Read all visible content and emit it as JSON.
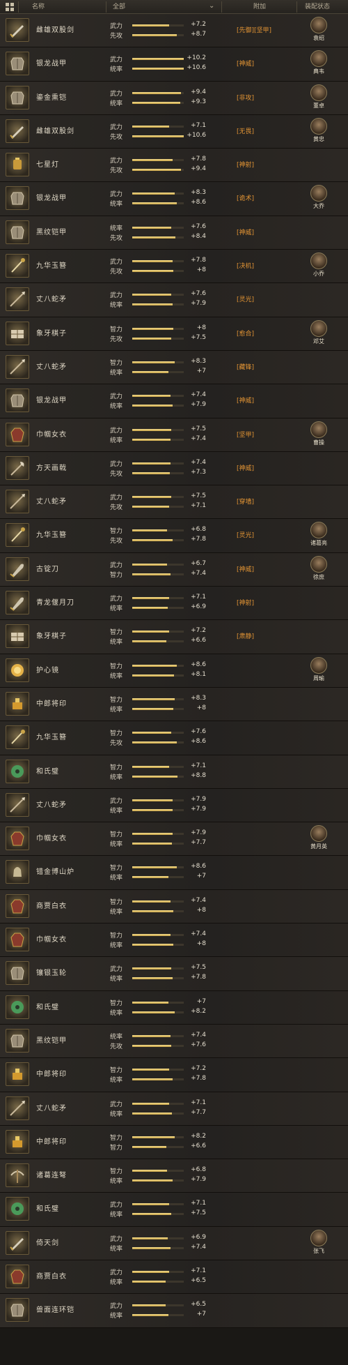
{
  "header": {
    "col_name": "名称",
    "col_all": "全部",
    "col_extra": "附加",
    "col_equip": "装配状态",
    "dropdown_icon": "chevron-down-icon"
  },
  "colors": {
    "extra_text": "#e29434",
    "bar_fill": "#e8c865"
  },
  "items": [
    {
      "name": "雌雄双股剑",
      "icon": "sword-icon",
      "stats": [
        {
          "label": "武力",
          "value": "+7.2",
          "fill": 0.72
        },
        {
          "label": "先攻",
          "value": "+8.7",
          "fill": 0.87
        }
      ],
      "extra": "[先御][坚甲]",
      "equipped": "袁绍"
    },
    {
      "name": "银龙战甲",
      "icon": "armor-icon",
      "stats": [
        {
          "label": "武力",
          "value": "+10.2",
          "fill": 1.0
        },
        {
          "label": "统率",
          "value": "+10.6",
          "fill": 1.0
        }
      ],
      "extra": "[神威]",
      "equipped": "典韦"
    },
    {
      "name": "鎏金熏铠",
      "icon": "armor-icon",
      "stats": [
        {
          "label": "武力",
          "value": "+9.4",
          "fill": 0.94
        },
        {
          "label": "统率",
          "value": "+9.3",
          "fill": 0.93
        }
      ],
      "extra": "[非攻]",
      "equipped": "董卓"
    },
    {
      "name": "雌雄双股剑",
      "icon": "sword-icon",
      "stats": [
        {
          "label": "武力",
          "value": "+7.1",
          "fill": 0.71
        },
        {
          "label": "先攻",
          "value": "+10.6",
          "fill": 1.0
        }
      ],
      "extra": "[无畏]",
      "equipped": "黄忠"
    },
    {
      "name": "七星灯",
      "icon": "lamp-icon",
      "stats": [
        {
          "label": "武力",
          "value": "+7.8",
          "fill": 0.78
        },
        {
          "label": "先攻",
          "value": "+9.4",
          "fill": 0.94
        }
      ],
      "extra": "[神射]",
      "equipped": ""
    },
    {
      "name": "银龙战甲",
      "icon": "armor-icon",
      "stats": [
        {
          "label": "武力",
          "value": "+8.3",
          "fill": 0.83
        },
        {
          "label": "统率",
          "value": "+8.6",
          "fill": 0.86
        }
      ],
      "extra": "[诡术]",
      "equipped": "大乔"
    },
    {
      "name": "黑纹铠甲",
      "icon": "armor-icon",
      "stats": [
        {
          "label": "统率",
          "value": "+7.6",
          "fill": 0.76
        },
        {
          "label": "先攻",
          "value": "+8.4",
          "fill": 0.84
        }
      ],
      "extra": "[神威]",
      "equipped": ""
    },
    {
      "name": "九华玉簪",
      "icon": "hairpin-icon",
      "stats": [
        {
          "label": "武力",
          "value": "+7.8",
          "fill": 0.78
        },
        {
          "label": "先攻",
          "value": "+8",
          "fill": 0.8
        }
      ],
      "extra": "[决机]",
      "equipped": "小乔"
    },
    {
      "name": "丈八蛇矛",
      "icon": "spear-icon",
      "stats": [
        {
          "label": "武力",
          "value": "+7.6",
          "fill": 0.76
        },
        {
          "label": "统率",
          "value": "+7.9",
          "fill": 0.79
        }
      ],
      "extra": "[灵光]",
      "equipped": ""
    },
    {
      "name": "象牙棋子",
      "icon": "chess-icon",
      "stats": [
        {
          "label": "智力",
          "value": "+8",
          "fill": 0.8
        },
        {
          "label": "先攻",
          "value": "+7.5",
          "fill": 0.75
        }
      ],
      "extra": "[愈合]",
      "equipped": "邓艾"
    },
    {
      "name": "丈八蛇矛",
      "icon": "spear-icon",
      "stats": [
        {
          "label": "智力",
          "value": "+8.3",
          "fill": 0.83
        },
        {
          "label": "统率",
          "value": "+7",
          "fill": 0.7
        }
      ],
      "extra": "[藏锋]",
      "equipped": ""
    },
    {
      "name": "银龙战甲",
      "icon": "armor-icon",
      "stats": [
        {
          "label": "武力",
          "value": "+7.4",
          "fill": 0.74
        },
        {
          "label": "统率",
          "value": "+7.9",
          "fill": 0.79
        }
      ],
      "extra": "[神威]",
      "equipped": ""
    },
    {
      "name": "巾帼女衣",
      "icon": "robe-icon",
      "stats": [
        {
          "label": "武力",
          "value": "+7.5",
          "fill": 0.75
        },
        {
          "label": "统率",
          "value": "+7.4",
          "fill": 0.74
        }
      ],
      "extra": "[坚甲]",
      "equipped": "曹操"
    },
    {
      "name": "方天画戟",
      "icon": "halberd-icon",
      "stats": [
        {
          "label": "武力",
          "value": "+7.4",
          "fill": 0.74
        },
        {
          "label": "先攻",
          "value": "+7.3",
          "fill": 0.73
        }
      ],
      "extra": "[神威]",
      "equipped": ""
    },
    {
      "name": "丈八蛇矛",
      "icon": "spear-icon",
      "stats": [
        {
          "label": "武力",
          "value": "+7.5",
          "fill": 0.75
        },
        {
          "label": "先攻",
          "value": "+7.1",
          "fill": 0.71
        }
      ],
      "extra": "[穿墙]",
      "equipped": ""
    },
    {
      "name": "九华玉簪",
      "icon": "hairpin-icon",
      "stats": [
        {
          "label": "智力",
          "value": "+6.8",
          "fill": 0.68
        },
        {
          "label": "先攻",
          "value": "+7.8",
          "fill": 0.78
        }
      ],
      "extra": "[灵光]",
      "equipped": "诸葛亮"
    },
    {
      "name": "古锭刀",
      "icon": "blade-icon",
      "stats": [
        {
          "label": "武力",
          "value": "+6.7",
          "fill": 0.67
        },
        {
          "label": "智力",
          "value": "+7.4",
          "fill": 0.74
        }
      ],
      "extra": "[神威]",
      "equipped": "徐庶"
    },
    {
      "name": "青龙偃月刀",
      "icon": "blade-icon",
      "stats": [
        {
          "label": "武力",
          "value": "+7.1",
          "fill": 0.71
        },
        {
          "label": "统率",
          "value": "+6.9",
          "fill": 0.69
        }
      ],
      "extra": "[神射]",
      "equipped": ""
    },
    {
      "name": "象牙棋子",
      "icon": "chess-icon",
      "stats": [
        {
          "label": "智力",
          "value": "+7.2",
          "fill": 0.72
        },
        {
          "label": "统率",
          "value": "+6.6",
          "fill": 0.66
        }
      ],
      "extra": "[肃静]",
      "equipped": ""
    },
    {
      "name": "护心镜",
      "icon": "mirror-icon",
      "stats": [
        {
          "label": "智力",
          "value": "+8.6",
          "fill": 0.86
        },
        {
          "label": "统率",
          "value": "+8.1",
          "fill": 0.81
        }
      ],
      "extra": "",
      "equipped": "周瑜"
    },
    {
      "name": "中郎将印",
      "icon": "seal-icon",
      "stats": [
        {
          "label": "智力",
          "value": "+8.3",
          "fill": 0.83
        },
        {
          "label": "统率",
          "value": "+8",
          "fill": 0.8
        }
      ],
      "extra": "",
      "equipped": ""
    },
    {
      "name": "九华玉簪",
      "icon": "hairpin-icon",
      "stats": [
        {
          "label": "智力",
          "value": "+7.6",
          "fill": 0.76
        },
        {
          "label": "先攻",
          "value": "+8.6",
          "fill": 0.86
        }
      ],
      "extra": "",
      "equipped": ""
    },
    {
      "name": "和氏璧",
      "icon": "jade-icon",
      "stats": [
        {
          "label": "智力",
          "value": "+7.1",
          "fill": 0.71
        },
        {
          "label": "统率",
          "value": "+8.8",
          "fill": 0.88
        }
      ],
      "extra": "",
      "equipped": ""
    },
    {
      "name": "丈八蛇矛",
      "icon": "spear-icon",
      "stats": [
        {
          "label": "武力",
          "value": "+7.9",
          "fill": 0.79
        },
        {
          "label": "统率",
          "value": "+7.9",
          "fill": 0.79
        }
      ],
      "extra": "",
      "equipped": ""
    },
    {
      "name": "巾帼女衣",
      "icon": "robe-icon",
      "stats": [
        {
          "label": "智力",
          "value": "+7.9",
          "fill": 0.79
        },
        {
          "label": "统率",
          "value": "+7.7",
          "fill": 0.77
        }
      ],
      "extra": "",
      "equipped": "黄月英"
    },
    {
      "name": "错金博山炉",
      "icon": "censer-icon",
      "stats": [
        {
          "label": "智力",
          "value": "+8.6",
          "fill": 0.86
        },
        {
          "label": "统率",
          "value": "+7",
          "fill": 0.7
        }
      ],
      "extra": "",
      "equipped": ""
    },
    {
      "name": "商贾白衣",
      "icon": "robe-icon",
      "stats": [
        {
          "label": "智力",
          "value": "+7.4",
          "fill": 0.74
        },
        {
          "label": "统率",
          "value": "+8",
          "fill": 0.8
        }
      ],
      "extra": "",
      "equipped": ""
    },
    {
      "name": "巾帼女衣",
      "icon": "robe-icon",
      "stats": [
        {
          "label": "智力",
          "value": "+7.4",
          "fill": 0.74
        },
        {
          "label": "统率",
          "value": "+8",
          "fill": 0.8
        }
      ],
      "extra": "",
      "equipped": ""
    },
    {
      "name": "镶银玉轮",
      "icon": "armor-icon",
      "stats": [
        {
          "label": "武力",
          "value": "+7.5",
          "fill": 0.75
        },
        {
          "label": "统率",
          "value": "+7.8",
          "fill": 0.78
        }
      ],
      "extra": "",
      "equipped": ""
    },
    {
      "name": "和氏璧",
      "icon": "jade-icon",
      "stats": [
        {
          "label": "智力",
          "value": "+7",
          "fill": 0.7
        },
        {
          "label": "统率",
          "value": "+8.2",
          "fill": 0.82
        }
      ],
      "extra": "",
      "equipped": ""
    },
    {
      "name": "黑纹铠甲",
      "icon": "armor-icon",
      "stats": [
        {
          "label": "统率",
          "value": "+7.4",
          "fill": 0.74
        },
        {
          "label": "先攻",
          "value": "+7.6",
          "fill": 0.76
        }
      ],
      "extra": "",
      "equipped": ""
    },
    {
      "name": "中郎将印",
      "icon": "seal-icon",
      "stats": [
        {
          "label": "智力",
          "value": "+7.2",
          "fill": 0.72
        },
        {
          "label": "统率",
          "value": "+7.8",
          "fill": 0.78
        }
      ],
      "extra": "",
      "equipped": ""
    },
    {
      "name": "丈八蛇矛",
      "icon": "spear-icon",
      "stats": [
        {
          "label": "武力",
          "value": "+7.1",
          "fill": 0.71
        },
        {
          "label": "统率",
          "value": "+7.7",
          "fill": 0.77
        }
      ],
      "extra": "",
      "equipped": ""
    },
    {
      "name": "中郎将印",
      "icon": "seal-icon",
      "stats": [
        {
          "label": "智力",
          "value": "+8.2",
          "fill": 0.82
        },
        {
          "label": "智力",
          "value": "+6.6",
          "fill": 0.66
        }
      ],
      "extra": "",
      "equipped": ""
    },
    {
      "name": "诸葛连弩",
      "icon": "crossbow-icon",
      "stats": [
        {
          "label": "智力",
          "value": "+6.8",
          "fill": 0.68
        },
        {
          "label": "统率",
          "value": "+7.9",
          "fill": 0.79
        }
      ],
      "extra": "",
      "equipped": ""
    },
    {
      "name": "和氏璧",
      "icon": "jade-icon",
      "stats": [
        {
          "label": "武力",
          "value": "+7.1",
          "fill": 0.71
        },
        {
          "label": "统率",
          "value": "+7.5",
          "fill": 0.75
        }
      ],
      "extra": "",
      "equipped": ""
    },
    {
      "name": "倚天剑",
      "icon": "sword-icon",
      "stats": [
        {
          "label": "武力",
          "value": "+6.9",
          "fill": 0.69
        },
        {
          "label": "统率",
          "value": "+7.4",
          "fill": 0.74
        }
      ],
      "extra": "",
      "equipped": "张飞"
    },
    {
      "name": "商贾白衣",
      "icon": "robe-icon",
      "stats": [
        {
          "label": "武力",
          "value": "+7.1",
          "fill": 0.71
        },
        {
          "label": "统率",
          "value": "+6.5",
          "fill": 0.65
        }
      ],
      "extra": "",
      "equipped": ""
    },
    {
      "name": "兽面连环铠",
      "icon": "armor-icon",
      "stats": [
        {
          "label": "武力",
          "value": "+6.5",
          "fill": 0.65
        },
        {
          "label": "统率",
          "value": "+7",
          "fill": 0.7
        }
      ],
      "extra": "",
      "equipped": ""
    }
  ]
}
